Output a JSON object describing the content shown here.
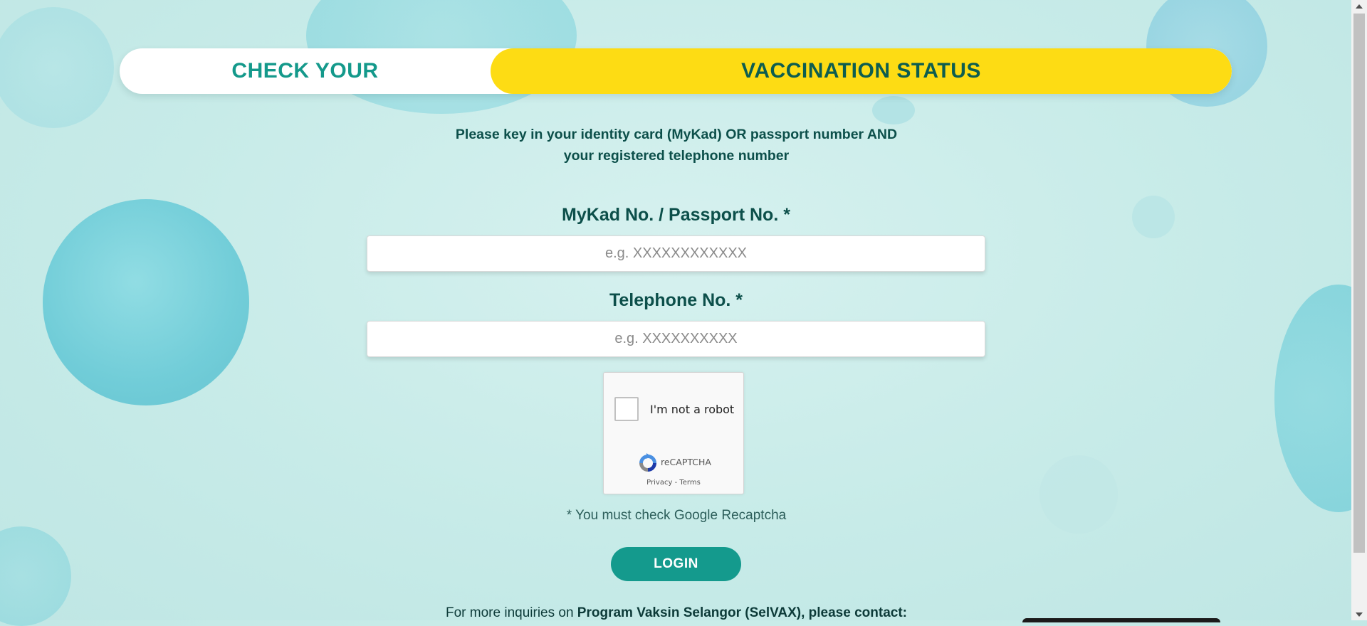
{
  "banner": {
    "left_text": "CHECK YOUR",
    "right_text": "VACCINATION STATUS"
  },
  "instructions": {
    "line1": "Please key in your identity card (MyKad) OR passport number AND",
    "line2": "your registered telephone number"
  },
  "form": {
    "id_label": "MyKad No. / Passport No. *",
    "id_placeholder": "e.g. XXXXXXXXXXXX",
    "id_value": "",
    "phone_label": "Telephone No. *",
    "phone_placeholder": "e.g. XXXXXXXXXX",
    "phone_value": ""
  },
  "recaptcha": {
    "label": "I'm not a robot",
    "brand": "reCAPTCHA",
    "privacy": "Privacy",
    "separator": " - ",
    "terms": "Terms"
  },
  "warning": "* You must check Google Recaptcha",
  "login_label": "LOGIN",
  "footer": {
    "prefix": "For more inquiries on ",
    "program": "Program Vaksin Selangor (SelVAX), please contact:"
  },
  "colors": {
    "accent_teal": "#149a8d",
    "banner_yellow": "#fddc14",
    "text_dark_teal": "#0c4f4a"
  }
}
